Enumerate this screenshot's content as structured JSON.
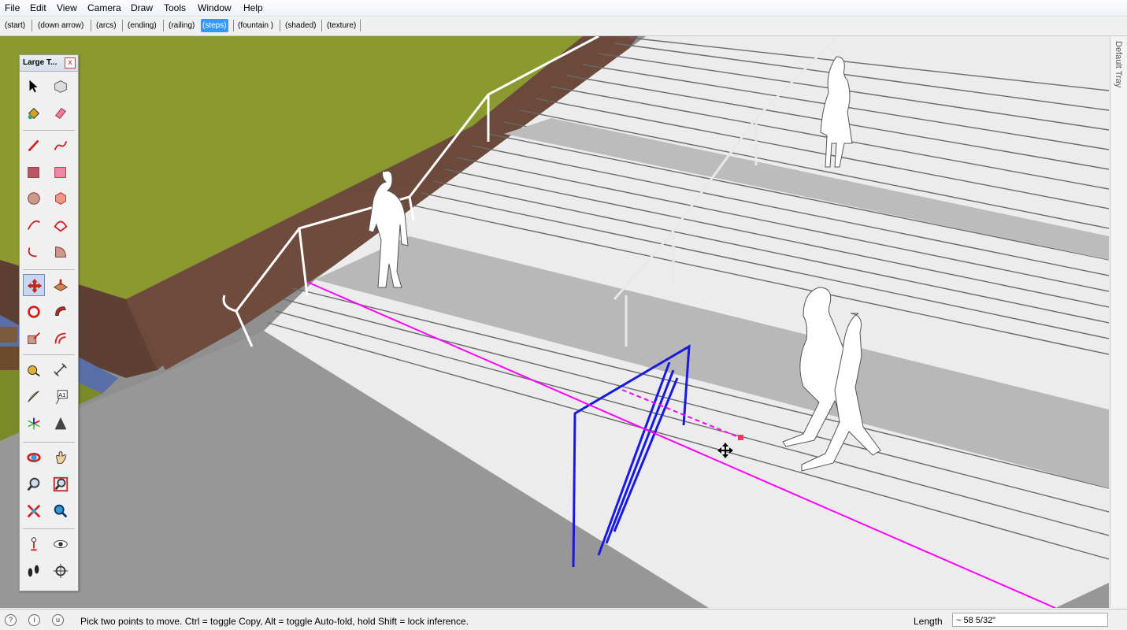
{
  "menu": [
    "File",
    "Edit",
    "View",
    "Camera",
    "Draw",
    "Tools",
    "Window",
    "Help"
  ],
  "scenes": [
    {
      "label": "(start)",
      "active": false
    },
    {
      "label": "(down arrow)",
      "active": false
    },
    {
      "label": "(arcs)",
      "active": false
    },
    {
      "label": "(ending)",
      "active": false
    },
    {
      "label": "(railing)",
      "active": false
    },
    {
      "label": "(steps)",
      "active": true
    },
    {
      "label": "(fountain )",
      "active": false
    },
    {
      "label": "(shaded)",
      "active": false
    },
    {
      "label": "(texture)",
      "active": false
    }
  ],
  "toolbar": {
    "title": "Large T...",
    "close": "x",
    "tools": [
      {
        "name": "select-tool-icon",
        "active": false
      },
      {
        "name": "make-component-tool-icon",
        "active": false
      },
      {
        "name": "paint-bucket-tool-icon",
        "active": false
      },
      {
        "name": "eraser-tool-icon",
        "active": false
      },
      {
        "name": "line-tool-icon",
        "active": false
      },
      {
        "name": "freehand-tool-icon",
        "active": false
      },
      {
        "name": "rectangle-tool-icon",
        "active": false
      },
      {
        "name": "rotated-rectangle-tool-icon",
        "active": false
      },
      {
        "name": "circle-tool-icon",
        "active": false
      },
      {
        "name": "polygon-tool-icon",
        "active": false
      },
      {
        "name": "arc-tool-icon",
        "active": false
      },
      {
        "name": "two-point-arc-tool-icon",
        "active": false
      },
      {
        "name": "three-point-arc-tool-icon",
        "active": false
      },
      {
        "name": "pie-tool-icon",
        "active": false
      },
      {
        "name": "move-tool-icon",
        "active": true
      },
      {
        "name": "push-pull-tool-icon",
        "active": false
      },
      {
        "name": "rotate-tool-icon",
        "active": false
      },
      {
        "name": "follow-me-tool-icon",
        "active": false
      },
      {
        "name": "scale-tool-icon",
        "active": false
      },
      {
        "name": "offset-tool-icon",
        "active": false
      },
      {
        "name": "tape-measure-tool-icon",
        "active": false
      },
      {
        "name": "dimension-tool-icon",
        "active": false
      },
      {
        "name": "protractor-tool-icon",
        "active": false
      },
      {
        "name": "text-tool-icon",
        "active": false
      },
      {
        "name": "axes-tool-icon",
        "active": false
      },
      {
        "name": "3d-text-tool-icon",
        "active": false
      },
      {
        "name": "orbit-tool-icon",
        "active": false
      },
      {
        "name": "pan-tool-icon",
        "active": false
      },
      {
        "name": "zoom-tool-icon",
        "active": false
      },
      {
        "name": "zoom-window-tool-icon",
        "active": false
      },
      {
        "name": "zoom-extents-tool-icon",
        "active": false
      },
      {
        "name": "previous-view-tool-icon",
        "active": false
      },
      {
        "name": "position-camera-tool-icon",
        "active": false
      },
      {
        "name": "look-around-tool-icon",
        "active": false
      },
      {
        "name": "walk-tool-icon",
        "active": false
      },
      {
        "name": "section-plane-tool-icon",
        "active": false
      }
    ],
    "text_tool_glyph": "A1"
  },
  "tray": {
    "label": "Default Tray"
  },
  "status": {
    "icons": [
      "geo-location-icon",
      "credits-icon",
      "user-icon"
    ],
    "icon_glyphs": [
      "?",
      "i",
      "u"
    ],
    "message": "Pick two points to move.  Ctrl = toggle Copy, Alt = toggle Auto-fold, hold Shift = lock inference.",
    "vcb_label": "Length",
    "vcb_value": "~ 58 5/32\""
  },
  "colors": {
    "grass": "#8a9a2e",
    "wall": "#6b4a3c",
    "steps": "#ececec",
    "ground": "#8f8f8f",
    "selected": "#1a1adf",
    "inference_magenta": "#ff00ff",
    "active_scene": "#3399ff"
  }
}
